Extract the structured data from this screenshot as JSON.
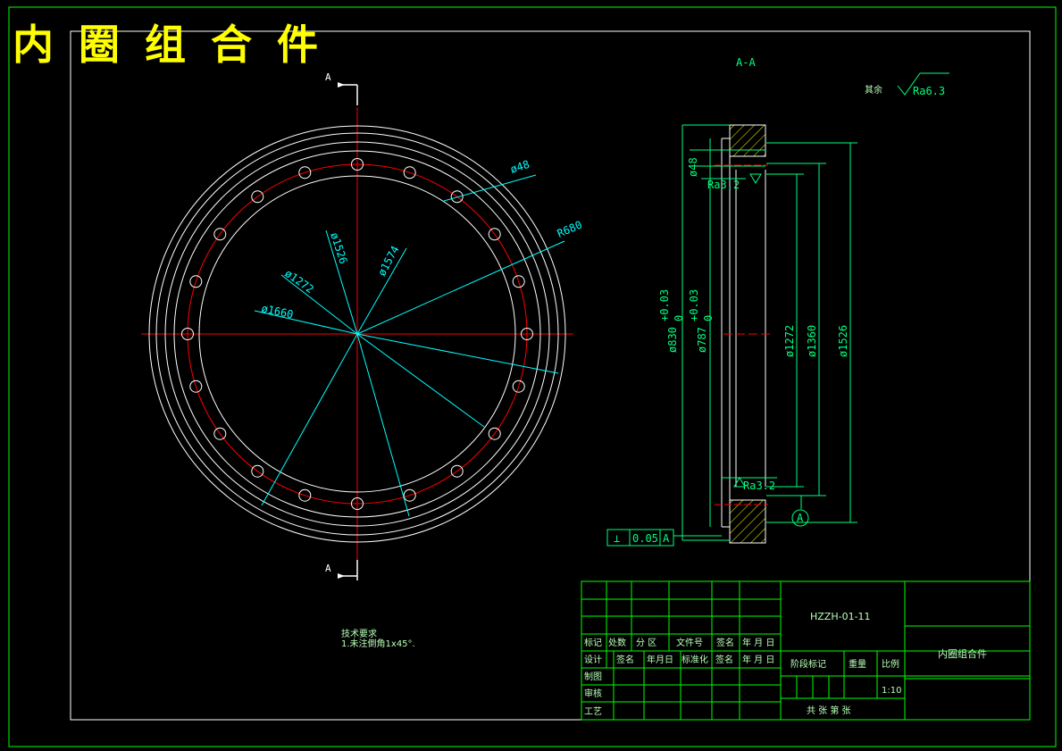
{
  "title": "内 圈 组 合 件",
  "section_label": "A-A",
  "cut_label_top": "A",
  "cut_label_bottom": "A",
  "roughness_other": "其余",
  "roughness_value": "Ra6.3",
  "front_view_dims": {
    "hole_dia": "ø48",
    "outer_radius": "R680",
    "d1526": "ø1526",
    "d1574": "ø1574",
    "d1272": "ø1272",
    "d1660": "ø1660"
  },
  "section_dims": {
    "d48": "ø48",
    "ra_top": "Ra3.2",
    "ra_bottom": "Ra3.2",
    "d830": "ø830",
    "d830_tol": "+0.03",
    "d830_tol2": "0",
    "d787": "ø787",
    "d787_tol": "+0.03",
    "d787_tol2": "0",
    "d1272": "ø1272",
    "d1360": "ø1360",
    "d1526": "ø1526",
    "datum": "A"
  },
  "tolerance_frame": {
    "symbol": "⊥",
    "value": "0.05",
    "datum": "A"
  },
  "notes": {
    "heading": "技术要求",
    "line1": "1.未注倒角1x45°."
  },
  "title_block": {
    "drawing_no": "HZZH-01-11",
    "part_name": "内圈组合件",
    "row_mark": [
      "标记",
      "处数",
      "分 区",
      "文件号",
      "签名",
      "年 月 日"
    ],
    "row_design": [
      "设计",
      "签名",
      "年月日",
      "标准化",
      "签名",
      "年 月 日"
    ],
    "drafting": "制图",
    "review": "审核",
    "process": "工艺",
    "stage_mark": "阶段标记",
    "weight": "重量",
    "scale_label": "比例",
    "scale": "1:10",
    "sheets": "共  张 第  张"
  },
  "colors": {
    "frame": "#00ff00",
    "geometry": "#ffffff",
    "centerline": "#ff0000",
    "dimension": "#00ffff",
    "title_text": "#ffff00"
  }
}
